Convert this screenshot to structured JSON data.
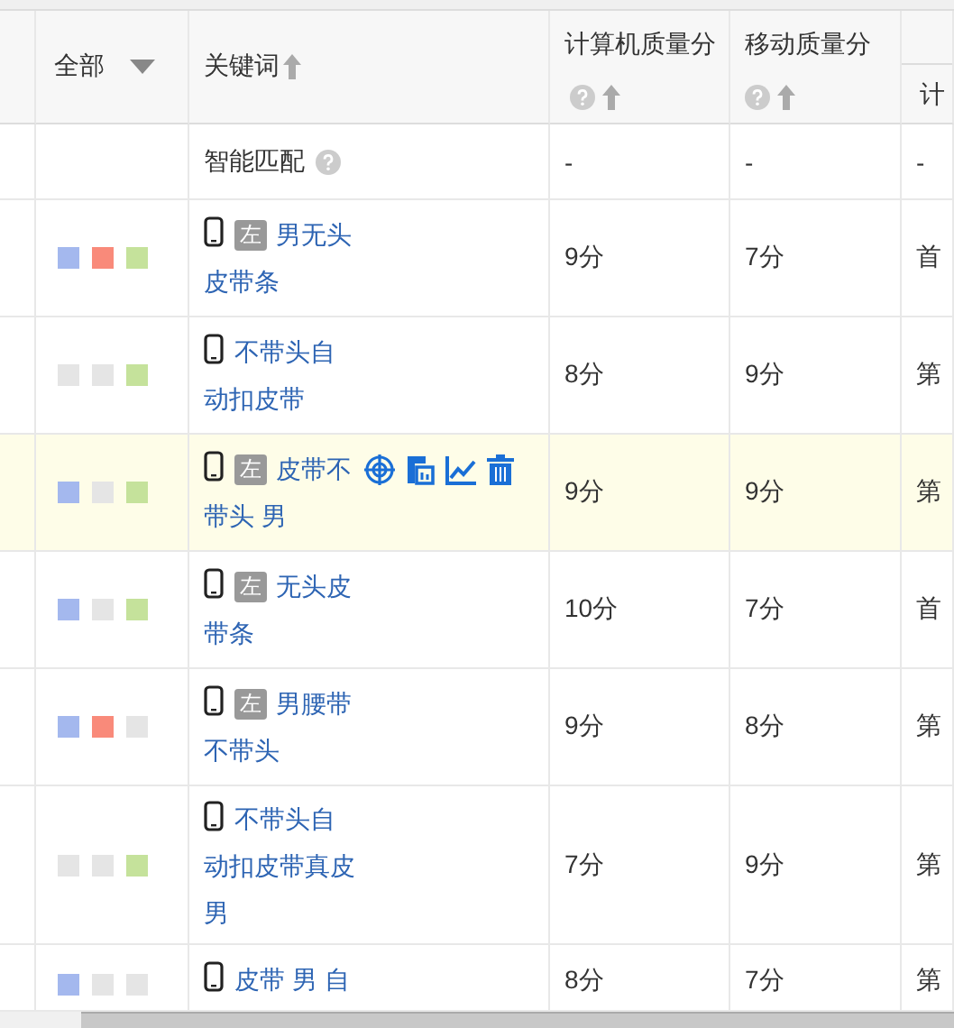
{
  "header": {
    "select_all": "全部",
    "keyword": "关键词",
    "pc_score": "计算机质量分",
    "mobile_score": "移动质量分",
    "column_6": "计"
  },
  "smart_match": {
    "label": "智能匹配",
    "pc_score": "-",
    "mobile_score": "-",
    "column_6": "-"
  },
  "rows": [
    {
      "markers": [
        {
          "color": "#a4b8ee"
        },
        {
          "color": "#f98a7a"
        },
        {
          "color": "#c5e29b"
        }
      ],
      "left_tag": "左",
      "keyword": "男无头皮带条",
      "pc_score": "9分",
      "mobile_score": "7分",
      "column_6": "首",
      "hovered": false
    },
    {
      "markers": [
        {
          "color": "#e5e5e5"
        },
        {
          "color": "#e5e5e5"
        },
        {
          "color": "#c5e29b"
        }
      ],
      "keyword": "不带头自动扣皮带",
      "pc_score": "8分",
      "mobile_score": "9分",
      "column_6": "第",
      "hovered": false
    },
    {
      "markers": [
        {
          "color": "#a4b8ee"
        },
        {
          "color": "#e5e5e5"
        },
        {
          "color": "#c5e29b"
        }
      ],
      "left_tag": "左",
      "keyword": "皮带不带头 男",
      "pc_score": "9分",
      "mobile_score": "9分",
      "column_6": "第",
      "hovered": true
    },
    {
      "markers": [
        {
          "color": "#a4b8ee"
        },
        {
          "color": "#e5e5e5"
        },
        {
          "color": "#c5e29b"
        }
      ],
      "left_tag": "左",
      "keyword": "无头皮带条",
      "pc_score": "10分",
      "mobile_score": "7分",
      "column_6": "首",
      "hovered": false
    },
    {
      "markers": [
        {
          "color": "#a4b8ee"
        },
        {
          "color": "#f98a7a"
        },
        {
          "color": "#e5e5e5"
        }
      ],
      "left_tag": "左",
      "keyword": "男腰带不带头",
      "pc_score": "9分",
      "mobile_score": "8分",
      "column_6": "第",
      "hovered": false
    },
    {
      "markers": [
        {
          "color": "#e5e5e5"
        },
        {
          "color": "#e5e5e5"
        },
        {
          "color": "#c5e29b"
        }
      ],
      "keyword": "不带头自动扣皮带真皮男",
      "pc_score": "7分",
      "mobile_score": "9分",
      "column_6": "第",
      "hovered": false
    },
    {
      "markers": [
        {
          "color": "#a4b8ee"
        },
        {
          "color": "#e5e5e5"
        },
        {
          "color": "#e5e5e5"
        }
      ],
      "keyword": "皮带 男 自",
      "pc_score": "8分",
      "mobile_score": "7分",
      "column_6": "第",
      "hovered": false
    }
  ]
}
